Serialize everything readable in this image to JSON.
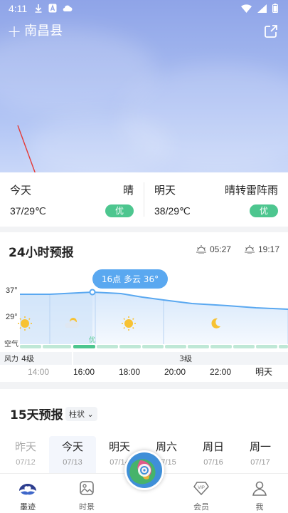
{
  "status_bar": {
    "time": "4:11"
  },
  "header": {
    "add_symbol": "+",
    "city": "南昌县"
  },
  "today": {
    "name": "今天",
    "condition": "晴",
    "temp": "37/29℃",
    "aqi": "优"
  },
  "tomorrow": {
    "name": "明天",
    "condition": "晴转雷阵雨",
    "temp": "38/29℃",
    "aqi": "优"
  },
  "hourly": {
    "title": "24小时预报",
    "sunrise": "05:27",
    "sunset": "19:17",
    "tooltip": "16点 多云 36°",
    "y_max_label": "37°",
    "y_min_label": "29°",
    "air_label": "空气",
    "air_quality_label": "优",
    "wind_label": "风力",
    "wind_segments": [
      "4级",
      "3级"
    ],
    "times": [
      "14:00",
      "16:00",
      "18:00",
      "20:00",
      "22:00",
      "明天"
    ],
    "icons": [
      "sun-icon",
      "partly-cloudy-icon",
      "sun-icon",
      "moon-icon"
    ]
  },
  "daily": {
    "title": "15天预报",
    "view_toggle": "柱状",
    "days": [
      {
        "name": "昨天",
        "date": "07/12"
      },
      {
        "name": "今天",
        "date": "07/13"
      },
      {
        "name": "明天",
        "date": "07/14"
      },
      {
        "name": "周六",
        "date": "07/15"
      },
      {
        "name": "周日",
        "date": "07/16"
      },
      {
        "name": "周一",
        "date": "07/17"
      }
    ]
  },
  "bottom_nav": {
    "items": [
      "墨迹",
      "时景",
      "会员",
      "我"
    ]
  },
  "colors": {
    "accent": "#4a90e2",
    "aqi_good": "#4dc68f",
    "tooltip": "#5aa8f0"
  }
}
